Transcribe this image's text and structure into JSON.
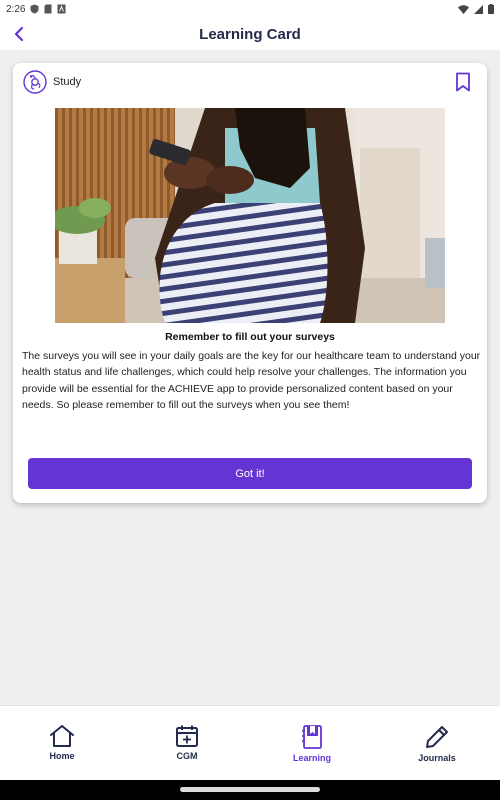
{
  "status_bar": {
    "time": "2:26"
  },
  "header": {
    "title": "Learning Card"
  },
  "card": {
    "tag": "Study",
    "image_alt": "Pregnant woman in striped dress using a smartphone",
    "heading": "Remember to fill out your surveys",
    "body": "The surveys you will see in your daily goals are the key for our healthcare team to understand your health status and life challenges, which could help resolve your challenges. The information you provide will be essential for the ACHIEVE app to provide personalized content based on your needs. So please remember to fill out the surveys when you see them!",
    "button_label": "Got it!"
  },
  "nav": {
    "items": [
      {
        "label": "Home",
        "icon": "home-icon",
        "active": false
      },
      {
        "label": "CGM",
        "icon": "calendar-plus-icon",
        "active": false
      },
      {
        "label": "Learning",
        "icon": "book-icon",
        "active": true
      },
      {
        "label": "Journals",
        "icon": "pencil-icon",
        "active": false
      }
    ]
  },
  "colors": {
    "accent": "#6535d4",
    "title": "#232c4a",
    "background": "#efefef"
  }
}
